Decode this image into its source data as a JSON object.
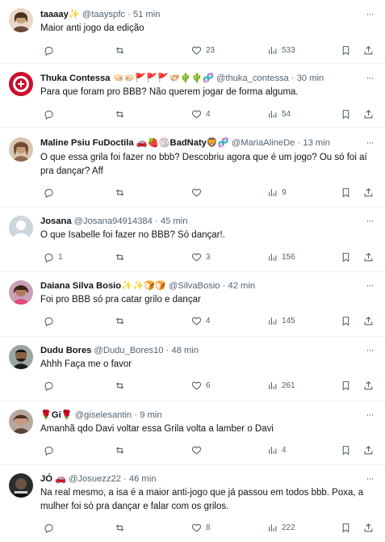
{
  "tweets": [
    {
      "name": "taaaay✨",
      "handle": "@taayspfc",
      "time": "51 min",
      "text": "Maior anti jogo da edição",
      "replies": "",
      "retweets": "",
      "likes": "23",
      "views": "533",
      "avatar_color": "#c9a27a"
    },
    {
      "name": "Thuka Contessa 🤜🏻🤛🏻🚩🚩🚩🫱🏻‍🫲🏼🌵🌵🧬",
      "handle": "@thuka_contessa",
      "time": "30 min",
      "text": "Para que foram pro BBB? Não querem jogar de forma alguma.",
      "replies": "",
      "retweets": "",
      "likes": "4",
      "views": "54",
      "avatar_color": "#c8102e"
    },
    {
      "name": "Maline Psiu FuDoctila 🚗🍓🏐BadNaty🦁🧬",
      "handle": "@MariaAlineDe",
      "time": "13 min",
      "text": "O que essa grila foi fazer no bbb? Descobriu agora que é um jogo? Ou só foi aí pra dançar? Aff",
      "replies": "",
      "retweets": "",
      "likes": "",
      "views": "9",
      "avatar_color": "#b08a68"
    },
    {
      "name": "Josana",
      "handle": "@Josana94914384",
      "time": "45 min",
      "text": "O que Isabelle foi fazer no BBB? Só dançar!.",
      "replies": "1",
      "retweets": "",
      "likes": "3",
      "views": "156",
      "avatar_color": "#ccd6dd"
    },
    {
      "name": "Daiana Silva Bosio✨✨🍞🍞",
      "handle": "@SilvaBosio",
      "time": "42 min",
      "text": "Foi pro BBB só pra catar grilo e dançar",
      "replies": "",
      "retweets": "",
      "likes": "4",
      "views": "145",
      "avatar_color": "#8a5a44"
    },
    {
      "name": "Dudu Bores",
      "handle": "@Dudu_Bores10",
      "time": "48 min",
      "text": "Ahhh Faça me o favor",
      "replies": "",
      "retweets": "",
      "likes": "6",
      "views": "261",
      "avatar_color": "#5a4636"
    },
    {
      "name": "🌹Gi🌹",
      "handle": "@giselesantin",
      "time": "9 min",
      "text": "Amanhã qdo Davi voltar essa Grila volta a lamber o Davi",
      "replies": "",
      "retweets": "",
      "likes": "",
      "views": "4",
      "avatar_color": "#7a5c4f"
    },
    {
      "name": "JÓ 🚗",
      "handle": "@Josuezz22",
      "time": "46 min",
      "text": "Na real mesmo, a isa é a maior anti-jogo que já passou em todos bbb. Poxa, a mulher foi só pra dançar e falar com os grilos.",
      "replies": "",
      "retweets": "",
      "likes": "8",
      "views": "222",
      "avatar_color": "#2b2b2b"
    }
  ],
  "colors": {
    "text": "#0f1419",
    "muted": "#536471",
    "divider": "#eff3f4"
  },
  "icons": {
    "reply": "reply-icon",
    "retweet": "retweet-icon",
    "like": "heart-icon",
    "views": "views-icon",
    "bookmark": "bookmark-icon",
    "share": "share-icon",
    "more": "more-icon"
  }
}
